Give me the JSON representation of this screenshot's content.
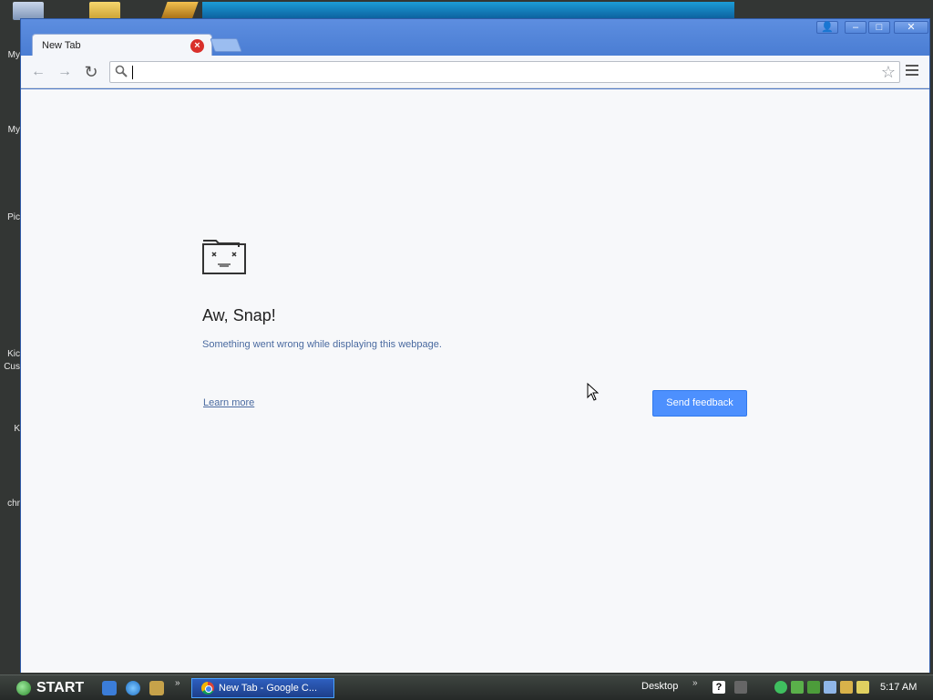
{
  "desktop": {
    "labels": [
      "My",
      "My",
      "Pic",
      "Kic",
      "Cus",
      "K",
      "chr"
    ]
  },
  "browser": {
    "tab": {
      "title": "New Tab",
      "close_glyph": "×"
    },
    "window_controls": {
      "profile": "👤",
      "minimize": "–",
      "maximize": "□",
      "close": "✕"
    },
    "toolbar": {
      "back_glyph": "←",
      "forward_glyph": "→",
      "reload_glyph": "↻",
      "omnibox_value": "",
      "omnibox_placeholder": "",
      "star_glyph": "☆"
    },
    "error_page": {
      "title": "Aw, Snap!",
      "description": "Something went wrong while displaying this webpage.",
      "learn_more": "Learn more",
      "feedback_button": "Send feedback"
    }
  },
  "taskbar": {
    "start_label": "START",
    "active_task": "New Tab - Google C...",
    "desktop_label": "Desktop",
    "chevron": "»",
    "help_glyph": "?",
    "clock": "5:17 AM"
  },
  "colors": {
    "accent": "#4d90fe",
    "window_frame": "#4a78c8",
    "link": "#4a6aa0"
  }
}
